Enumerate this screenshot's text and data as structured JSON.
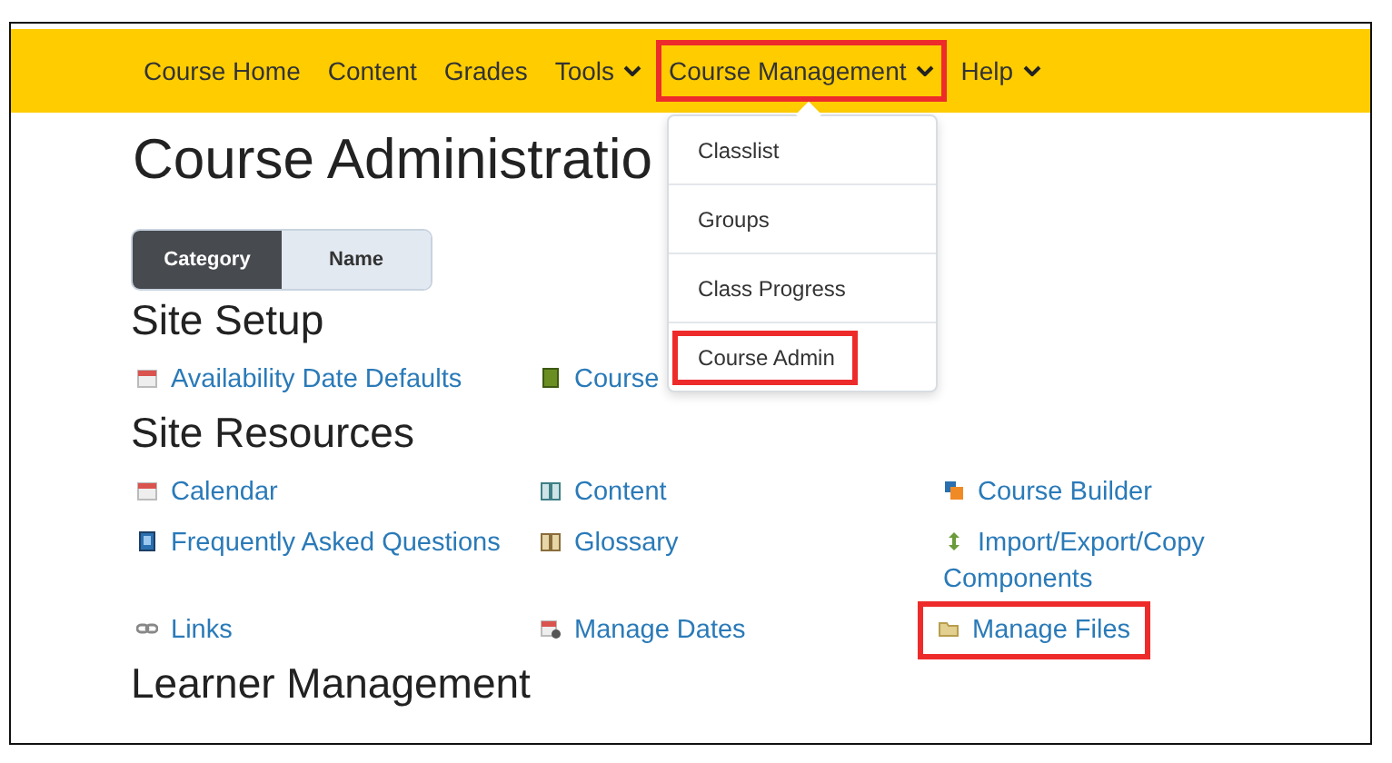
{
  "nav": [
    {
      "label": "Course Home",
      "dropdown": false,
      "highlighted": false
    },
    {
      "label": "Content",
      "dropdown": false,
      "highlighted": false
    },
    {
      "label": "Grades",
      "dropdown": false,
      "highlighted": false
    },
    {
      "label": "Tools",
      "dropdown": true,
      "highlighted": false
    },
    {
      "label": "Course Management",
      "dropdown": true,
      "highlighted": true
    },
    {
      "label": "Help",
      "dropdown": true,
      "highlighted": false
    }
  ],
  "menu": [
    {
      "label": "Classlist",
      "highlighted": false
    },
    {
      "label": "Groups",
      "highlighted": false
    },
    {
      "label": "Class Progress",
      "highlighted": false
    },
    {
      "label": "Course Admin",
      "highlighted": true
    }
  ],
  "title": "Course Administratio",
  "view_toggle": [
    {
      "label": "Category",
      "selected": true
    },
    {
      "label": "Name",
      "selected": false
    }
  ],
  "sections": [
    {
      "heading": "Site Setup",
      "links": [
        {
          "label": "Availability Date Defaults",
          "kind": "calendar",
          "highlighted": false
        },
        {
          "label": "Course",
          "kind": "green-book",
          "highlighted": false
        }
      ]
    },
    {
      "heading": "Site Resources",
      "links": [
        {
          "label": "Calendar",
          "kind": "calendar",
          "highlighted": false
        },
        {
          "label": "Content",
          "kind": "open-book",
          "highlighted": false
        },
        {
          "label": "Course Builder",
          "kind": "blocks",
          "highlighted": false
        },
        {
          "label": "Frequently Asked Questions",
          "kind": "blue-book",
          "highlighted": false
        },
        {
          "label": "Glossary",
          "kind": "tan-book",
          "highlighted": false
        },
        {
          "label": "Import/Export/Copy Components",
          "kind": "arrows",
          "highlighted": false
        },
        {
          "label": "Links",
          "kind": "chain",
          "highlighted": false
        },
        {
          "label": "Manage Dates",
          "kind": "calendar-gear",
          "highlighted": false
        },
        {
          "label": "Manage Files",
          "kind": "folder",
          "highlighted": true
        }
      ]
    },
    {
      "heading": "Learner Management"
    }
  ]
}
